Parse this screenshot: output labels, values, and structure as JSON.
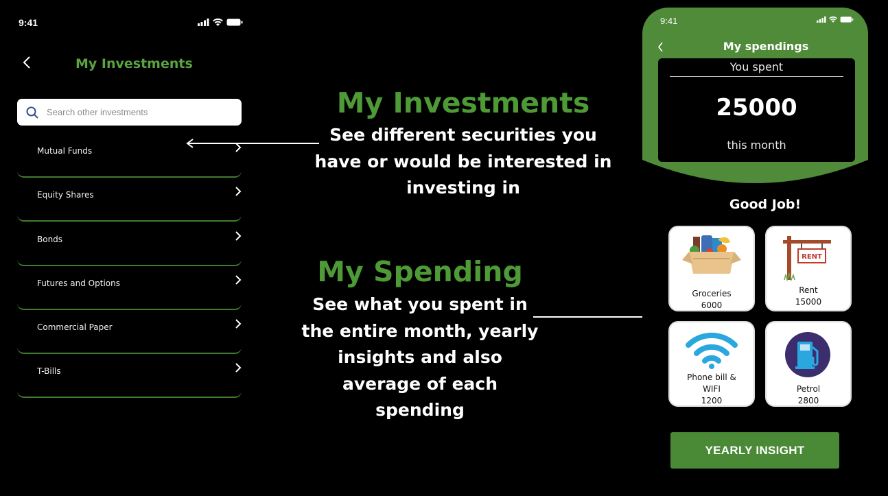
{
  "left_phone": {
    "status_time": "9:41",
    "title": "My Investments",
    "search": {
      "placeholder": "Search other investments"
    },
    "items": [
      {
        "label": "Mutual Funds"
      },
      {
        "label": "Equity Shares"
      },
      {
        "label": "Bonds"
      },
      {
        "label": "Futures and Options"
      },
      {
        "label": "Commercial Paper"
      },
      {
        "label": "T-Bills"
      }
    ]
  },
  "annotations": {
    "investments": {
      "heading": "My Investments",
      "lines": [
        "See different securities you",
        "have or would be interested in",
        "investing in"
      ]
    },
    "spending": {
      "heading": "My Spending",
      "lines": [
        "See what you spent in",
        "the entire month, yearly",
        "insights and also",
        "average of each",
        "spending"
      ]
    }
  },
  "right_phone": {
    "status_time": "9:41",
    "title": "My spendings",
    "summary": {
      "top": "You spent",
      "amount": "25000",
      "bottom": "this month"
    },
    "message": "Good Job!",
    "categories": [
      {
        "name": "Groceries",
        "amount": "6000",
        "icon": "groceries-box-icon"
      },
      {
        "name": "Rent",
        "amount": "15000",
        "icon": "rent-sign-icon",
        "sign_text": "RENT"
      },
      {
        "name_line1": "Phone bill &",
        "name_line2": "WIFI",
        "amount": "1200",
        "icon": "wifi-icon"
      },
      {
        "name": "Petrol",
        "amount": "2800",
        "icon": "fuel-pump-icon"
      }
    ],
    "button_label": "YEARLY INSIGHT",
    "colors": {
      "brand_green": "#4a8a36",
      "header_green": "#4f8b39"
    }
  }
}
